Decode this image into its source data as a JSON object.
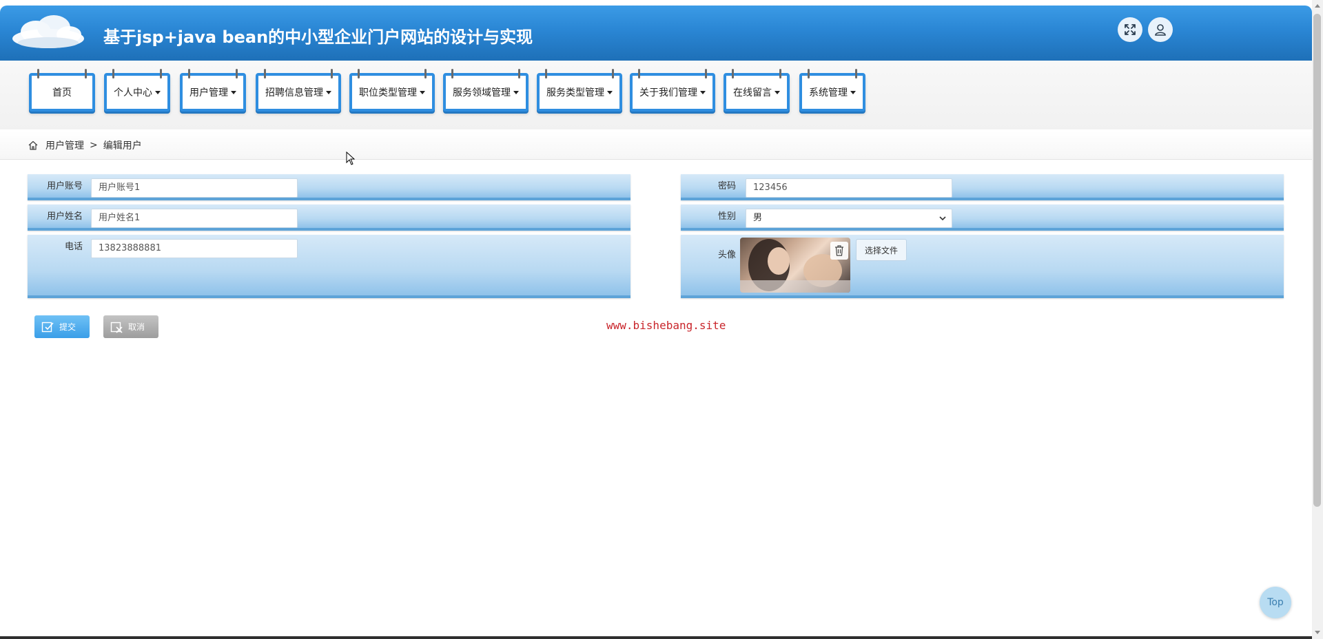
{
  "header": {
    "title": "基于jsp+java bean的中小型企业门户网站的设计与实现",
    "fullscreen_icon": "expand-icon",
    "user_icon": "user-icon"
  },
  "nav": {
    "items": [
      {
        "label": "首页",
        "dropdown": false
      },
      {
        "label": "个人中心",
        "dropdown": true
      },
      {
        "label": "用户管理",
        "dropdown": true
      },
      {
        "label": "招聘信息管理",
        "dropdown": true
      },
      {
        "label": "职位类型管理",
        "dropdown": true
      },
      {
        "label": "服务领域管理",
        "dropdown": true
      },
      {
        "label": "服务类型管理",
        "dropdown": true
      },
      {
        "label": "关于我们管理",
        "dropdown": true
      },
      {
        "label": "在线留言",
        "dropdown": true
      },
      {
        "label": "系统管理",
        "dropdown": true
      }
    ]
  },
  "breadcrumb": {
    "parent": "用户管理",
    "separator": ">",
    "current": "编辑用户"
  },
  "form": {
    "account": {
      "label": "用户账号",
      "value": "用户账号1"
    },
    "password": {
      "label": "密码",
      "value": "123456"
    },
    "name": {
      "label": "用户姓名",
      "value": "用户姓名1"
    },
    "gender": {
      "label": "性别",
      "value": "男"
    },
    "phone": {
      "label": "电话",
      "value": "13823888881"
    },
    "avatar": {
      "label": "头像",
      "file_button": "选择文件"
    }
  },
  "buttons": {
    "submit": "提交",
    "cancel": "取消"
  },
  "watermark": "www.bishebang.site",
  "top_button": "Top",
  "colors": {
    "header_blue": "#2a86d4",
    "nav_border": "#2f8ee0",
    "form_row": "#b8d9f2",
    "watermark_red": "#c9252b"
  }
}
